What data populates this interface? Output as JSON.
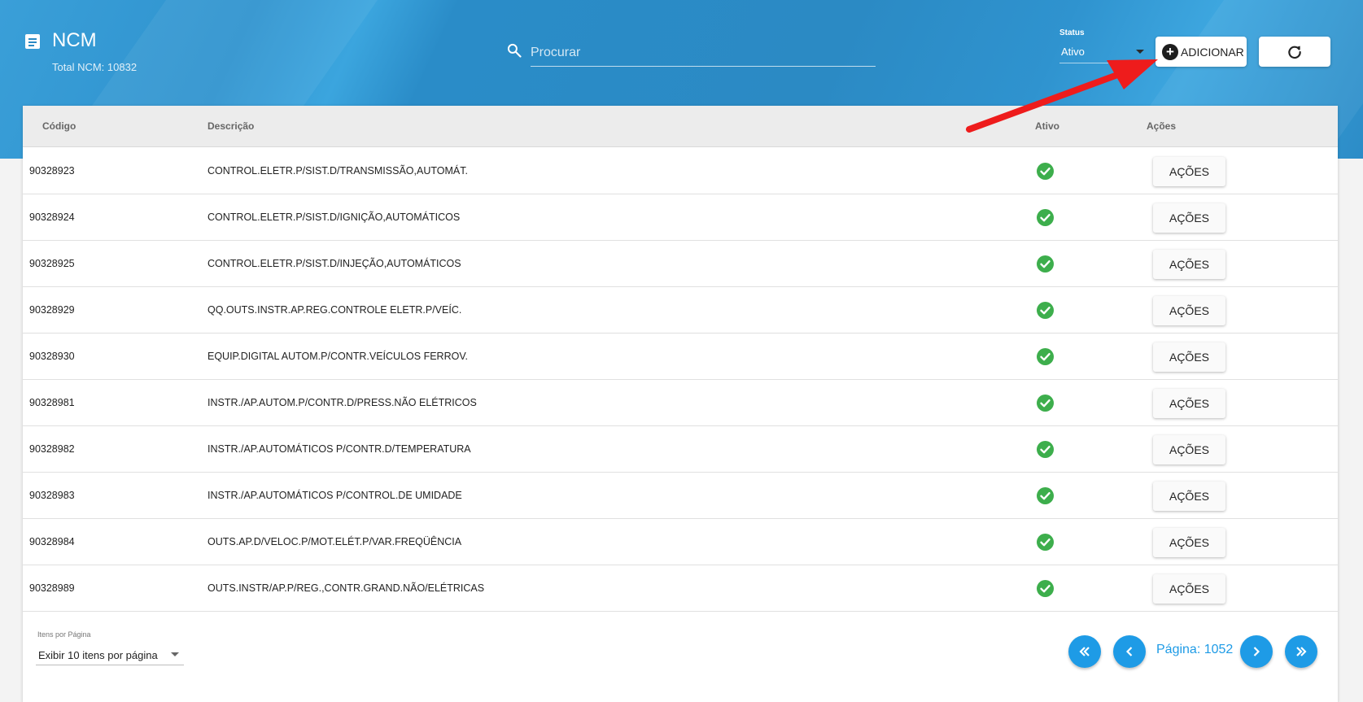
{
  "header": {
    "title": "NCM",
    "subtitle": "Total NCM: 10832",
    "icons": [
      "document-icon",
      "search-icon",
      "refresh-icon"
    ]
  },
  "search": {
    "placeholder": "Procurar",
    "value": ""
  },
  "status": {
    "label": "Status",
    "selected": "Ativo"
  },
  "toolbar": {
    "add_label": "ADICIONAR"
  },
  "table": {
    "columns": [
      "Código",
      "Descrição",
      "Ativo",
      "Ações"
    ],
    "rows": [
      {
        "code": "90328923",
        "description": "CONTROL.ELETR.P/SIST.D/TRANSMISSÃO,AUTOMÁT.",
        "active": true,
        "action": "AÇÕES"
      },
      {
        "code": "90328924",
        "description": "CONTROL.ELETR.P/SIST.D/IGNIÇÃO,AUTOMÁTICOS",
        "active": true,
        "action": "AÇÕES"
      },
      {
        "code": "90328925",
        "description": "CONTROL.ELETR.P/SIST.D/INJEÇÃO,AUTOMÁTICOS",
        "active": true,
        "action": "AÇÕES"
      },
      {
        "code": "90328929",
        "description": "QQ.OUTS.INSTR.AP.REG.CONTROLE ELETR.P/VEÍC.",
        "active": true,
        "action": "AÇÕES"
      },
      {
        "code": "90328930",
        "description": "EQUIP.DIGITAL AUTOM.P/CONTR.VEÍCULOS FERROV.",
        "active": true,
        "action": "AÇÕES"
      },
      {
        "code": "90328981",
        "description": "INSTR./AP.AUTOM.P/CONTR.D/PRESS.NÃO ELÉTRICOS",
        "active": true,
        "action": "AÇÕES"
      },
      {
        "code": "90328982",
        "description": "INSTR./AP.AUTOMÁTICOS P/CONTR.D/TEMPERATURA",
        "active": true,
        "action": "AÇÕES"
      },
      {
        "code": "90328983",
        "description": "INSTR./AP.AUTOMÁTICOS P/CONTROL.DE UMIDADE",
        "active": true,
        "action": "AÇÕES"
      },
      {
        "code": "90328984",
        "description": "OUTS.AP.D/VELOC.P/MOT.ELÉT.P/VAR.FREQÜÊNCIA",
        "active": true,
        "action": "AÇÕES"
      },
      {
        "code": "90328989",
        "description": "OUTS.INSTR/AP.P/REG.,CONTR.GRAND.NÃO/ELÉTRICAS",
        "active": true,
        "action": "AÇÕES"
      }
    ]
  },
  "pagination": {
    "per_page_label": "Itens por Página",
    "per_page_value": "Exibir 10 itens por página",
    "page_label": "Página: 1052"
  },
  "colors": {
    "header_blue": "#2b8ac4",
    "accent": "#1e9be6",
    "active_green": "#3dae4c",
    "annotation_red": "#ee1c1c"
  }
}
